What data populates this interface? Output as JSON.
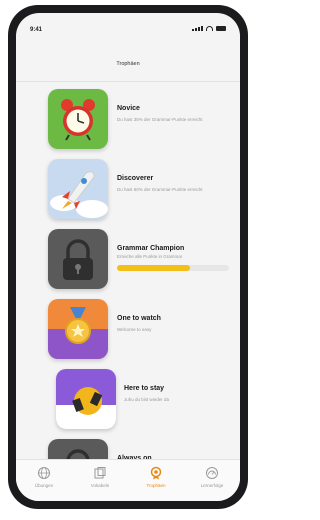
{
  "status": {
    "time": "9:41"
  },
  "header": {
    "title": "Trophäen"
  },
  "trophies": [
    {
      "title": "Novice",
      "description": "Du hast 35% der Grammar-Punkte erreicht",
      "icon": "alarm-clock-icon",
      "color": "#6cb944"
    },
    {
      "title": "Discoverer",
      "description": "Du hast 60% der Grammar-Punkte erreicht",
      "icon": "rocket-icon",
      "color": "#c7daf0"
    },
    {
      "title": "Grammar Champion",
      "description": "Erreiche alle Punkte in Grammar",
      "icon": "padlock-icon",
      "color": "#5a5a5a",
      "progress": 0.65
    },
    {
      "title": "One to watch",
      "description": "Welcome to easy",
      "icon": "medal-icon",
      "color": "#f08a3a"
    },
    {
      "title": "Here to stay",
      "description": "Juhu du bist wieder da",
      "icon": "sticker-icon",
      "color": "#8a5ad8"
    },
    {
      "title": "Always on",
      "description": "",
      "icon": "padlock-icon",
      "color": "#5a5a5a"
    }
  ],
  "tabs": [
    {
      "label": "Übungen",
      "icon": "globe-icon",
      "active": false
    },
    {
      "label": "Vokabeln",
      "icon": "cards-icon",
      "active": false
    },
    {
      "label": "Trophäen",
      "icon": "trophy-icon",
      "active": true
    },
    {
      "label": "Lernerfolge",
      "icon": "gauge-icon",
      "active": false
    }
  ],
  "colors": {
    "accent": "#e98a14",
    "progress": "#f2c019"
  }
}
